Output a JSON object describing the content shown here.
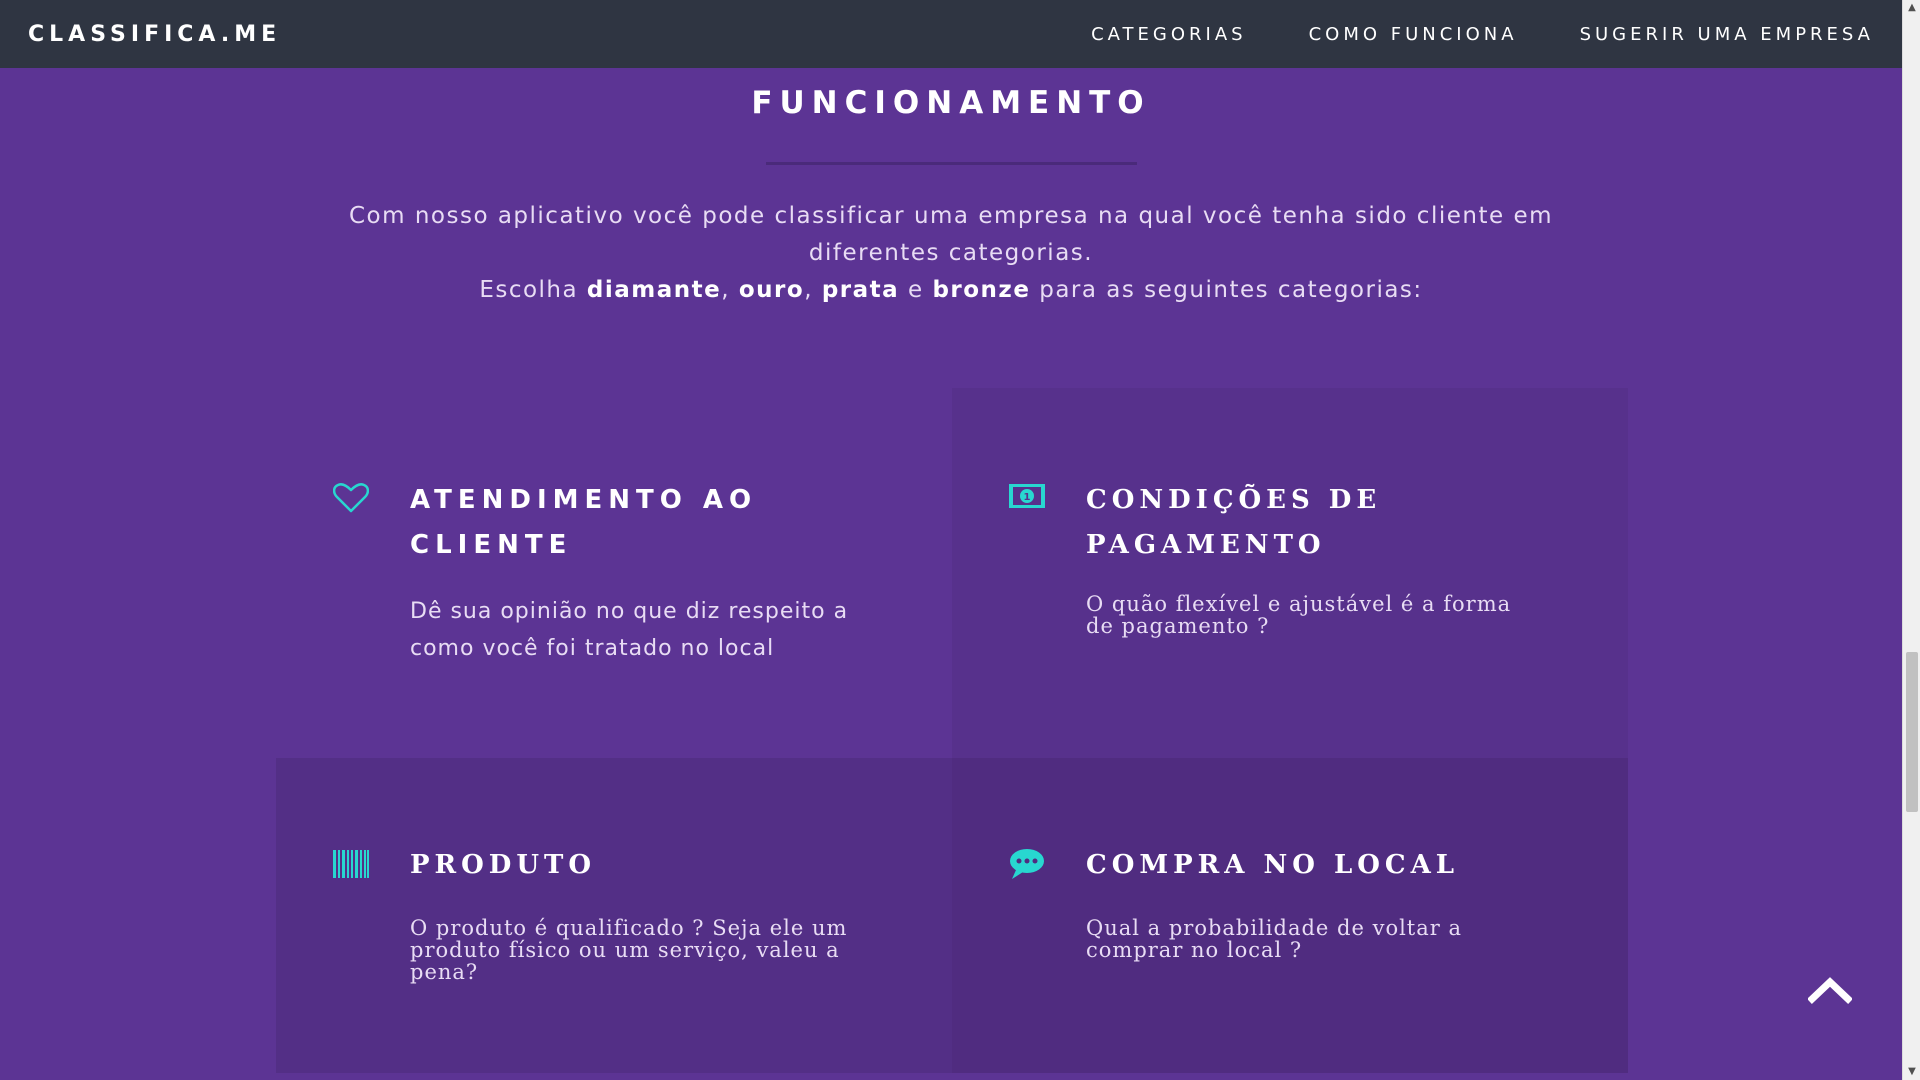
{
  "nav": {
    "brand": "CLASSIFICA.ME",
    "links": [
      "CATEGORIAS",
      "COMO FUNCIONA",
      "SUGERIR UMA EMPRESA"
    ]
  },
  "section": {
    "title": "FUNCIONAMENTO",
    "intro_line1": "Com nosso aplicativo você pode classificar uma empresa na qual você tenha sido cliente em diferentes categorias.",
    "intro_line2_prefix": "Escolha ",
    "level_diamante": "diamante",
    "sep1": ", ",
    "level_ouro": "ouro",
    "sep2": ", ",
    "level_prata": "prata",
    "sep3": " e ",
    "level_bronze": "bronze",
    "intro_line2_suffix": " para as seguintes categorias:"
  },
  "cards": [
    {
      "icon": "heart-icon",
      "title": "ATENDIMENTO AO CLIENTE",
      "text": "Dê sua opinião no que diz respeito a como você foi tratado no local",
      "bg": "#5c3494"
    },
    {
      "icon": "money-icon",
      "title": "CONDIÇÕES DE PAGAMENTO",
      "text": "O quão flexível e ajustável é a forma de pagamento ?",
      "bg": "#57318c"
    },
    {
      "icon": "barcode-icon",
      "title": "PRODUTO",
      "text": "O produto é qualificado ? Seja ele um produto físico ou um serviço, valeu a pena?",
      "bg": "#532f86"
    },
    {
      "icon": "chat-icon",
      "title": "COMPRA NO LOCAL",
      "text": "Qual a probabilidade de voltar a comprar no local ?",
      "bg": "#502c80"
    }
  ],
  "colors": {
    "accent": "#28d7d0",
    "background": "#5c3494",
    "navbar": "#2f3542"
  },
  "back_to_top_icon": "chevron-up-icon"
}
